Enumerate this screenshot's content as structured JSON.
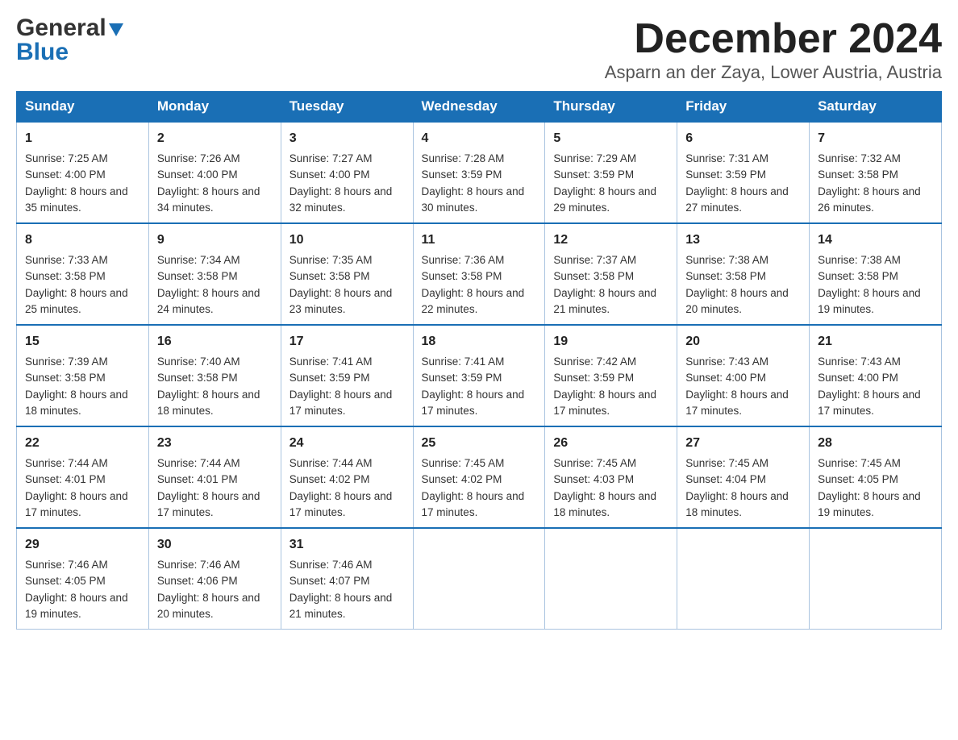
{
  "header": {
    "logo_general": "General",
    "logo_blue": "Blue",
    "title": "December 2024",
    "location": "Asparn an der Zaya, Lower Austria, Austria"
  },
  "weekdays": [
    "Sunday",
    "Monday",
    "Tuesday",
    "Wednesday",
    "Thursday",
    "Friday",
    "Saturday"
  ],
  "weeks": [
    [
      {
        "day": "1",
        "sunrise": "7:25 AM",
        "sunset": "4:00 PM",
        "daylight": "8 hours and 35 minutes."
      },
      {
        "day": "2",
        "sunrise": "7:26 AM",
        "sunset": "4:00 PM",
        "daylight": "8 hours and 34 minutes."
      },
      {
        "day": "3",
        "sunrise": "7:27 AM",
        "sunset": "4:00 PM",
        "daylight": "8 hours and 32 minutes."
      },
      {
        "day": "4",
        "sunrise": "7:28 AM",
        "sunset": "3:59 PM",
        "daylight": "8 hours and 30 minutes."
      },
      {
        "day": "5",
        "sunrise": "7:29 AM",
        "sunset": "3:59 PM",
        "daylight": "8 hours and 29 minutes."
      },
      {
        "day": "6",
        "sunrise": "7:31 AM",
        "sunset": "3:59 PM",
        "daylight": "8 hours and 27 minutes."
      },
      {
        "day": "7",
        "sunrise": "7:32 AM",
        "sunset": "3:58 PM",
        "daylight": "8 hours and 26 minutes."
      }
    ],
    [
      {
        "day": "8",
        "sunrise": "7:33 AM",
        "sunset": "3:58 PM",
        "daylight": "8 hours and 25 minutes."
      },
      {
        "day": "9",
        "sunrise": "7:34 AM",
        "sunset": "3:58 PM",
        "daylight": "8 hours and 24 minutes."
      },
      {
        "day": "10",
        "sunrise": "7:35 AM",
        "sunset": "3:58 PM",
        "daylight": "8 hours and 23 minutes."
      },
      {
        "day": "11",
        "sunrise": "7:36 AM",
        "sunset": "3:58 PM",
        "daylight": "8 hours and 22 minutes."
      },
      {
        "day": "12",
        "sunrise": "7:37 AM",
        "sunset": "3:58 PM",
        "daylight": "8 hours and 21 minutes."
      },
      {
        "day": "13",
        "sunrise": "7:38 AM",
        "sunset": "3:58 PM",
        "daylight": "8 hours and 20 minutes."
      },
      {
        "day": "14",
        "sunrise": "7:38 AM",
        "sunset": "3:58 PM",
        "daylight": "8 hours and 19 minutes."
      }
    ],
    [
      {
        "day": "15",
        "sunrise": "7:39 AM",
        "sunset": "3:58 PM",
        "daylight": "8 hours and 18 minutes."
      },
      {
        "day": "16",
        "sunrise": "7:40 AM",
        "sunset": "3:58 PM",
        "daylight": "8 hours and 18 minutes."
      },
      {
        "day": "17",
        "sunrise": "7:41 AM",
        "sunset": "3:59 PM",
        "daylight": "8 hours and 17 minutes."
      },
      {
        "day": "18",
        "sunrise": "7:41 AM",
        "sunset": "3:59 PM",
        "daylight": "8 hours and 17 minutes."
      },
      {
        "day": "19",
        "sunrise": "7:42 AM",
        "sunset": "3:59 PM",
        "daylight": "8 hours and 17 minutes."
      },
      {
        "day": "20",
        "sunrise": "7:43 AM",
        "sunset": "4:00 PM",
        "daylight": "8 hours and 17 minutes."
      },
      {
        "day": "21",
        "sunrise": "7:43 AM",
        "sunset": "4:00 PM",
        "daylight": "8 hours and 17 minutes."
      }
    ],
    [
      {
        "day": "22",
        "sunrise": "7:44 AM",
        "sunset": "4:01 PM",
        "daylight": "8 hours and 17 minutes."
      },
      {
        "day": "23",
        "sunrise": "7:44 AM",
        "sunset": "4:01 PM",
        "daylight": "8 hours and 17 minutes."
      },
      {
        "day": "24",
        "sunrise": "7:44 AM",
        "sunset": "4:02 PM",
        "daylight": "8 hours and 17 minutes."
      },
      {
        "day": "25",
        "sunrise": "7:45 AM",
        "sunset": "4:02 PM",
        "daylight": "8 hours and 17 minutes."
      },
      {
        "day": "26",
        "sunrise": "7:45 AM",
        "sunset": "4:03 PM",
        "daylight": "8 hours and 18 minutes."
      },
      {
        "day": "27",
        "sunrise": "7:45 AM",
        "sunset": "4:04 PM",
        "daylight": "8 hours and 18 minutes."
      },
      {
        "day": "28",
        "sunrise": "7:45 AM",
        "sunset": "4:05 PM",
        "daylight": "8 hours and 19 minutes."
      }
    ],
    [
      {
        "day": "29",
        "sunrise": "7:46 AM",
        "sunset": "4:05 PM",
        "daylight": "8 hours and 19 minutes."
      },
      {
        "day": "30",
        "sunrise": "7:46 AM",
        "sunset": "4:06 PM",
        "daylight": "8 hours and 20 minutes."
      },
      {
        "day": "31",
        "sunrise": "7:46 AM",
        "sunset": "4:07 PM",
        "daylight": "8 hours and 21 minutes."
      },
      null,
      null,
      null,
      null
    ]
  ]
}
